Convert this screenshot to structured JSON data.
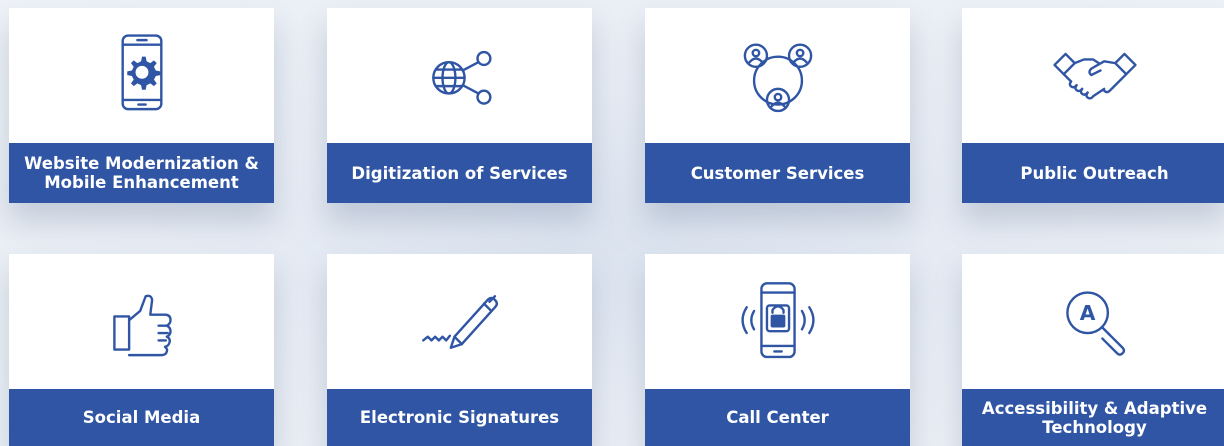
{
  "services": [
    {
      "label": "Website Modernization & Mobile Enhancement",
      "icon": "mobile-gear-icon"
    },
    {
      "label": "Digitization of Services",
      "icon": "globe-share-icon"
    },
    {
      "label": "Customer Services",
      "icon": "customers-network-icon"
    },
    {
      "label": "Public Outreach",
      "icon": "handshake-icon"
    },
    {
      "label": "Social Media",
      "icon": "thumbs-up-icon"
    },
    {
      "label": "Electronic Signatures",
      "icon": "pen-signature-icon"
    },
    {
      "label": "Call Center",
      "icon": "phone-lock-icon"
    },
    {
      "label": "Accessibility & Adaptive Technology",
      "icon": "magnifier-accessibility-icon"
    }
  ],
  "accessibility_icon_letter": "A",
  "colors": {
    "accent": "#2f55a4",
    "card": "#ffffff",
    "background": "#e7ecf4"
  }
}
